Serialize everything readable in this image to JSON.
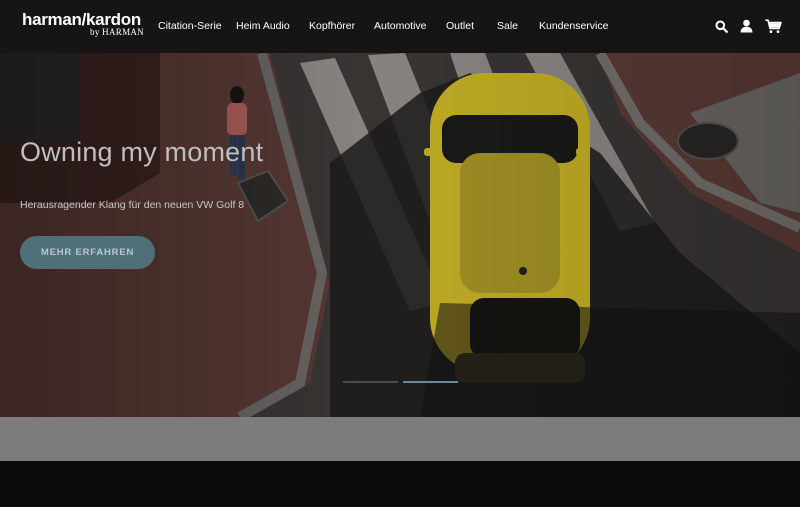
{
  "header": {
    "logo_text": "harman/kardon",
    "logo_sub": "by HARMAN",
    "nav": [
      {
        "label": "Citation-Serie"
      },
      {
        "label": "Heim Audio"
      },
      {
        "label": "Kopfhörer"
      },
      {
        "label": "Automotive"
      },
      {
        "label": "Outlet"
      },
      {
        "label": "Sale"
      },
      {
        "label": "Kundenservice"
      }
    ],
    "icons": [
      "search-icon",
      "user-icon",
      "cart-icon"
    ]
  },
  "hero": {
    "title": "Owning my moment",
    "subtitle": "Herausragender Klang für den neuen VW Golf 8",
    "cta_label": "MEHR ERFAHREN",
    "carousel": {
      "slides": 2,
      "active_index": 1
    }
  },
  "colors": {
    "header_bg": "#151515",
    "cta_bg": "#4f6f79",
    "car_yellow": "#c9b426",
    "gray_band": "#7c7c7c"
  }
}
